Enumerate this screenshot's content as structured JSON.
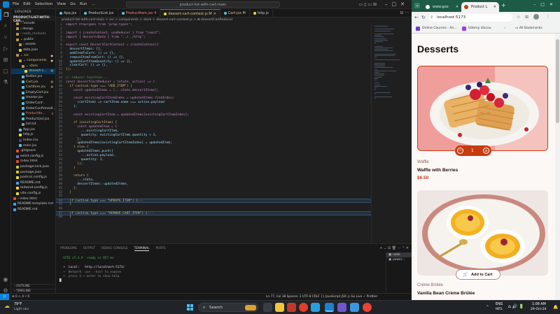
{
  "vscode": {
    "menu": [
      "File",
      "Edit",
      "Selection",
      "View",
      "Go",
      "Run",
      "…"
    ],
    "command_center": "product-list-with-cart-main",
    "explorer_title": "EXPLORER",
    "project_name": "PRODUCT-LIST-WITH-CAR...",
    "tree": [
      {
        "label": "› .vscode",
        "depth": 1,
        "color": "#ccc",
        "icon": "folder-icon",
        "badge": ""
      },
      {
        "label": "› design",
        "depth": 1,
        "color": "#ccc",
        "icon": "folder-icon",
        "badge": ""
      },
      {
        "label": "› node_modules",
        "depth": 1,
        "color": "#888",
        "icon": "folder-icon",
        "badge": ""
      },
      {
        "label": "⌄ public",
        "depth": 1,
        "color": "#ccc",
        "icon": "folder-icon",
        "badge": ""
      },
      {
        "label": "› assets",
        "depth": 2,
        "color": "#ccc",
        "icon": "folder-icon",
        "badge": ""
      },
      {
        "label": "data.json",
        "depth": 2,
        "color": "#ccc",
        "icon": "json-icon",
        "badge": ""
      },
      {
        "label": "⌄ src",
        "depth": 1,
        "color": "#e2c08d",
        "icon": "folder-icon",
        "badge": "●"
      },
      {
        "label": "⌄ components",
        "depth": 2,
        "color": "#e2c08d",
        "icon": "folder-icon",
        "badge": "●"
      },
      {
        "label": "⌄ store",
        "depth": 3,
        "color": "#e2c08d",
        "icon": "folder-icon",
        "badge": ""
      },
      {
        "label": "dessert-c...",
        "depth": 4,
        "color": "#e2c08d",
        "icon": "js-icon",
        "badge": "M",
        "selected": true
      },
      {
        "label": "Button.jsx",
        "depth": 3,
        "color": "#ccc",
        "icon": "react-icon",
        "badge": ""
      },
      {
        "label": "Cart.jsx",
        "depth": 3,
        "color": "#e2c08d",
        "icon": "react-icon",
        "badge": "M"
      },
      {
        "label": "CartItem.jsx",
        "depth": 3,
        "color": "#e2c08d",
        "icon": "react-icon",
        "badge": "M"
      },
      {
        "label": "EmptyCart.jsx",
        "depth": 3,
        "color": "#ccc",
        "icon": "react-icon",
        "badge": ""
      },
      {
        "label": "Header.jsx",
        "depth": 3,
        "color": "#ccc",
        "icon": "react-icon",
        "badge": ""
      },
      {
        "label": "OrderConf...",
        "depth": 3,
        "color": "#ccc",
        "icon": "react-icon",
        "badge": ""
      },
      {
        "label": "OrderConfirmedI...",
        "depth": 3,
        "color": "#ccc",
        "icon": "react-icon",
        "badge": ""
      },
      {
        "label": "ProductIte...",
        "depth": 3,
        "color": "#f48771",
        "icon": "react-icon",
        "badge": "4"
      },
      {
        "label": "ProductList.jsx",
        "depth": 3,
        "color": "#ccc",
        "icon": "react-icon",
        "badge": ""
      },
      {
        "label": "list.txt",
        "depth": 3,
        "color": "#ccc",
        "icon": "file-icon",
        "badge": ""
      },
      {
        "label": "App.jsx",
        "depth": 2,
        "color": "#ccc",
        "icon": "react-icon",
        "badge": ""
      },
      {
        "label": "http.js",
        "depth": 2,
        "color": "#ccc",
        "icon": "js-icon",
        "badge": ""
      },
      {
        "label": "index.css",
        "depth": 2,
        "color": "#ccc",
        "icon": "css-icon",
        "badge": ""
      },
      {
        "label": "main.jsx",
        "depth": 2,
        "color": "#ccc",
        "icon": "react-icon",
        "badge": ""
      },
      {
        "label": ".gitignore",
        "depth": 1,
        "color": "#ccc",
        "icon": "git-icon",
        "badge": ""
      },
      {
        "label": "eslint.config.js",
        "depth": 1,
        "color": "#ccc",
        "icon": "eslint-icon",
        "badge": ""
      },
      {
        "label": "index.html",
        "depth": 1,
        "color": "#ccc",
        "icon": "html-icon",
        "badge": ""
      },
      {
        "label": "package-lock.json",
        "depth": 1,
        "color": "#ccc",
        "icon": "json-icon",
        "badge": ""
      },
      {
        "label": "package.json",
        "depth": 1,
        "color": "#ccc",
        "icon": "json-icon",
        "badge": ""
      },
      {
        "label": "postcss.config.js",
        "depth": 1,
        "color": "#ccc",
        "icon": "js-icon",
        "badge": ""
      },
      {
        "label": "README.md",
        "depth": 1,
        "color": "#ccc",
        "icon": "info-icon",
        "badge": ""
      },
      {
        "label": "tailwind.config.js",
        "depth": 1,
        "color": "#ccc",
        "icon": "js-icon",
        "badge": ""
      },
      {
        "label": "vite.config.js",
        "depth": 1,
        "color": "#ccc",
        "icon": "js-icon",
        "badge": ""
      },
      {
        "label": "› index.html",
        "depth": 0,
        "color": "#ccc",
        "icon": "html-icon",
        "badge": ""
      },
      {
        "label": "README-template.md",
        "depth": 0,
        "color": "#ccc",
        "icon": "info-icon",
        "badge": ""
      },
      {
        "label": "README.md",
        "depth": 0,
        "color": "#ccc",
        "icon": "info-icon",
        "badge": ""
      }
    ],
    "outline_label": "OUTLINE",
    "timeline_label": "TIMELINE",
    "tabs": [
      {
        "label": "App.jsx",
        "active": false,
        "color": "#ccc"
      },
      {
        "label": "ProductList.jsx",
        "active": false,
        "color": "#ccc"
      },
      {
        "label": "ProductItem.jsx 4",
        "active": false,
        "color": "#f48771"
      },
      {
        "label": "dessert-cart-context.js M",
        "active": true,
        "color": "#e2c08d"
      },
      {
        "label": "Cart.jsx M",
        "active": false,
        "color": "#e2c08d"
      },
      {
        "label": "http.js",
        "active": false,
        "color": "#ccc"
      }
    ],
    "breadcrumb": "product-list-with-cart-main > src > components > store > dessert-cart-context.js > ⊞ dessertCartReducer",
    "code": [
      {
        "n": "1",
        "t": "import PropTypes from \"prop-types\";"
      },
      {
        "n": "2",
        "t": ""
      },
      {
        "n": "3",
        "t": "import { createContext, useReducer } from \"react\";"
      },
      {
        "n": "4",
        "t": "import { dessertsData } from \"../../http\";"
      },
      {
        "n": "5",
        "t": ""
      },
      {
        "n": "6",
        "t": "export const DessertCartContext = createContext({"
      },
      {
        "n": "7",
        "t": "  dessertItems: [],"
      },
      {
        "n": "8",
        "t": "  addItemToCart: () => {},"
      },
      {
        "n": "9",
        "t": "  removeItemFromCart: () => {},"
      },
      {
        "n": "10",
        "t": "  updateCartItemQuantity: () => {},"
      },
      {
        "n": "11",
        "t": "  clearCart: () => {},"
      },
      {
        "n": "12",
        "t": "});"
      },
      {
        "n": "13",
        "t": ""
      },
      {
        "n": "14",
        "t": "// reducer function..."
      },
      {
        "n": "15",
        "t": "const dessertCartReducer = (state, action) => {"
      },
      {
        "n": "16",
        "t": "  if (action.type === \"ADD_ITEM\") {"
      },
      {
        "n": "17",
        "t": "    const updatedItems = [...state.dessertItems];"
      },
      {
        "n": "18",
        "t": ""
      },
      {
        "n": "19",
        "t": "    const existingCartItemIndex = updatedItems.findIndex("
      },
      {
        "n": "20",
        "t": "      (cartItem) => cartItem.name === action.payload"
      },
      {
        "n": "21",
        "t": "    );"
      },
      {
        "n": "22",
        "t": ""
      },
      {
        "n": "23",
        "t": "    const existingCartItem = updatedItems[existingCartItemIndex];"
      },
      {
        "n": "24",
        "t": ""
      },
      {
        "n": "25",
        "t": "    if (existingCartItem) {"
      },
      {
        "n": "26",
        "t": "      const updatedItem = {"
      },
      {
        "n": "27",
        "t": "        ...existingCartItem,"
      },
      {
        "n": "28",
        "t": "        quantity: existingCartItem.quantity + 1,"
      },
      {
        "n": "29",
        "t": "      };"
      },
      {
        "n": "30",
        "t": "      updatedItems[existingCartItemIndex] = updatedItem;"
      },
      {
        "n": "31",
        "t": "    } else {"
      },
      {
        "n": "32",
        "t": "      updatedItems.push({"
      },
      {
        "n": "33",
        "t": "        ...action.payload,"
      },
      {
        "n": "34",
        "t": "        quantity: 1,"
      },
      {
        "n": "35",
        "t": "      });"
      },
      {
        "n": "36",
        "t": "    }"
      },
      {
        "n": "37",
        "t": ""
      },
      {
        "n": "38",
        "t": "    return {"
      },
      {
        "n": "39",
        "t": "      ...state,"
      },
      {
        "n": "40",
        "t": "      dessertItems: updatedItems,"
      },
      {
        "n": "41",
        "t": "    };"
      },
      {
        "n": "42",
        "t": "  }"
      },
      {
        "n": "43",
        "t": ""
      },
      {
        "n": "44",
        "t": "  if (action.type === \"UPDATE_ITEM\") {···",
        "hl": true
      },
      {
        "n": "45",
        "t": "  }"
      },
      {
        "n": "46",
        "t": ""
      },
      {
        "n": "47",
        "t": "  if (action.type === \"REMOVE_CART_ITEM\") {···",
        "hl": true
      },
      {
        "n": "48",
        "t": "  }"
      }
    ],
    "panel_tabs": [
      {
        "label": "PROBLEMS",
        "active": false
      },
      {
        "label": "OUTPUT",
        "active": false
      },
      {
        "label": "DEBUG CONSOLE",
        "active": false
      },
      {
        "label": "TERMINAL",
        "active": true
      },
      {
        "label": "PORTS",
        "active": false
      }
    ],
    "terminal": [
      "",
      "  VITE v5.4.9  ready in 957 ms",
      "",
      "  ➜  Local:   http://localhost:5173/",
      "  ➜  Network: use --host to expose",
      "  ➜  press h + enter to show help",
      "█"
    ],
    "terminal_list": [
      "node",
      "power..."
    ],
    "status_left": "⊗ 0 ⚠ 4   ⑂ 0",
    "status_right": "Ln 77, Col 38   Spaces: 2   UTF-8   CRLF   {} JavaScript JSX   ◎ Go Live   ✓ Prettier"
  },
  "browser": {
    "tabs": [
      {
        "label": "www.goo",
        "active": false
      },
      {
        "label": "Product L",
        "active": true
      }
    ],
    "url": "localhost:5173",
    "bookmarks": [
      "Online Courses - An...",
      "Udemy discou"
    ],
    "all_bookmarks": "All Bookmarks",
    "page_title": "Desserts",
    "products": [
      {
        "category": "Waffle",
        "name": "Waffle with Berries",
        "price": "$6.50",
        "quantity": "1"
      },
      {
        "category": "Crème Brûlée",
        "name": "Vanilla Bean Crème Brûlée",
        "price": "",
        "button": "Add to Cart"
      }
    ],
    "accent_color": "#c73b0f"
  },
  "taskbar": {
    "weather_temp": "79°F",
    "weather_desc": "Light rain",
    "search_placeholder": "Search",
    "lang_top": "ENG",
    "lang_bottom": "INTL",
    "time": "1:08 AM",
    "date": "29-Oct-24"
  }
}
